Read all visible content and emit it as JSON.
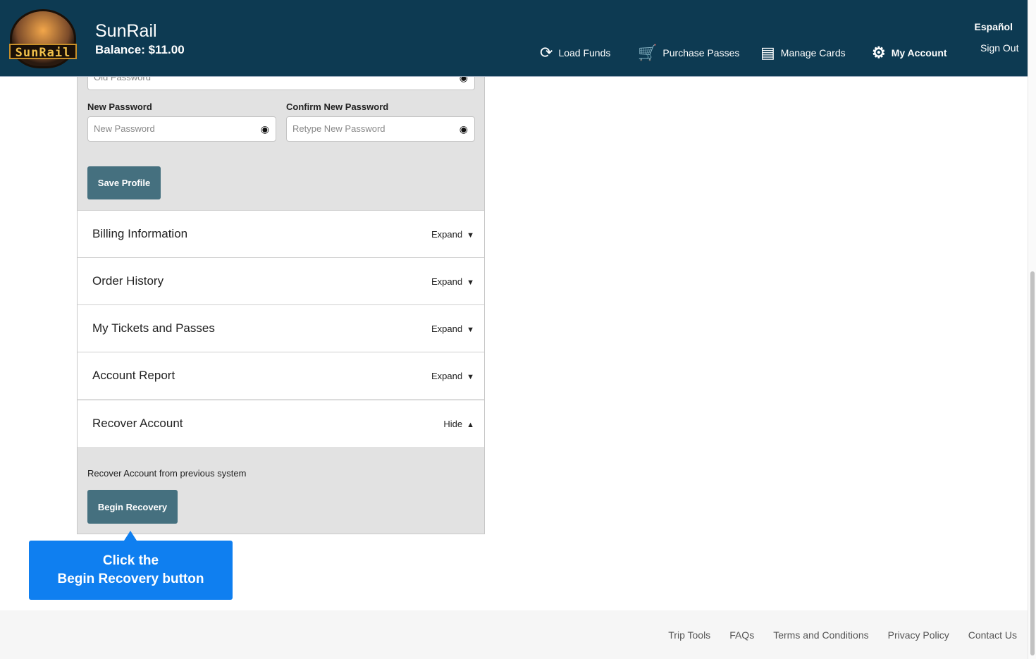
{
  "header": {
    "brand": "SunRail",
    "logo_text": "SunRail",
    "balance": "Balance: $11.00",
    "language": "Español",
    "nav": [
      {
        "label": "Load Funds",
        "icon": "dollar-refresh-icon"
      },
      {
        "label": "Purchase Passes",
        "icon": "cart-icon"
      },
      {
        "label": "Manage Cards",
        "icon": "card-icon"
      },
      {
        "label": "My Account",
        "icon": "gears-icon"
      },
      {
        "label": "Sign Out"
      }
    ]
  },
  "profile": {
    "old_password_placeholder": "Old Password",
    "new_password_label": "New Password",
    "new_password_placeholder": "New Password",
    "confirm_label": "Confirm New Password",
    "confirm_placeholder": "Retype New Password",
    "save": "Save Profile"
  },
  "sections": [
    {
      "title": "Billing Information",
      "toggle": "Expand"
    },
    {
      "title": "Order History",
      "toggle": "Expand"
    },
    {
      "title": "My Tickets and Passes",
      "toggle": "Expand"
    },
    {
      "title": "Account Report",
      "toggle": "Expand"
    },
    {
      "title": "Recover Account",
      "toggle": "Hide"
    }
  ],
  "recover": {
    "text": "Recover Account from previous system",
    "button": "Begin Recovery"
  },
  "callout": {
    "line1": "Click the",
    "line2": "Begin Recovery button"
  },
  "footer": [
    "Trip Tools",
    "FAQs",
    "Terms and Conditions",
    "Privacy Policy",
    "Contact Us"
  ]
}
